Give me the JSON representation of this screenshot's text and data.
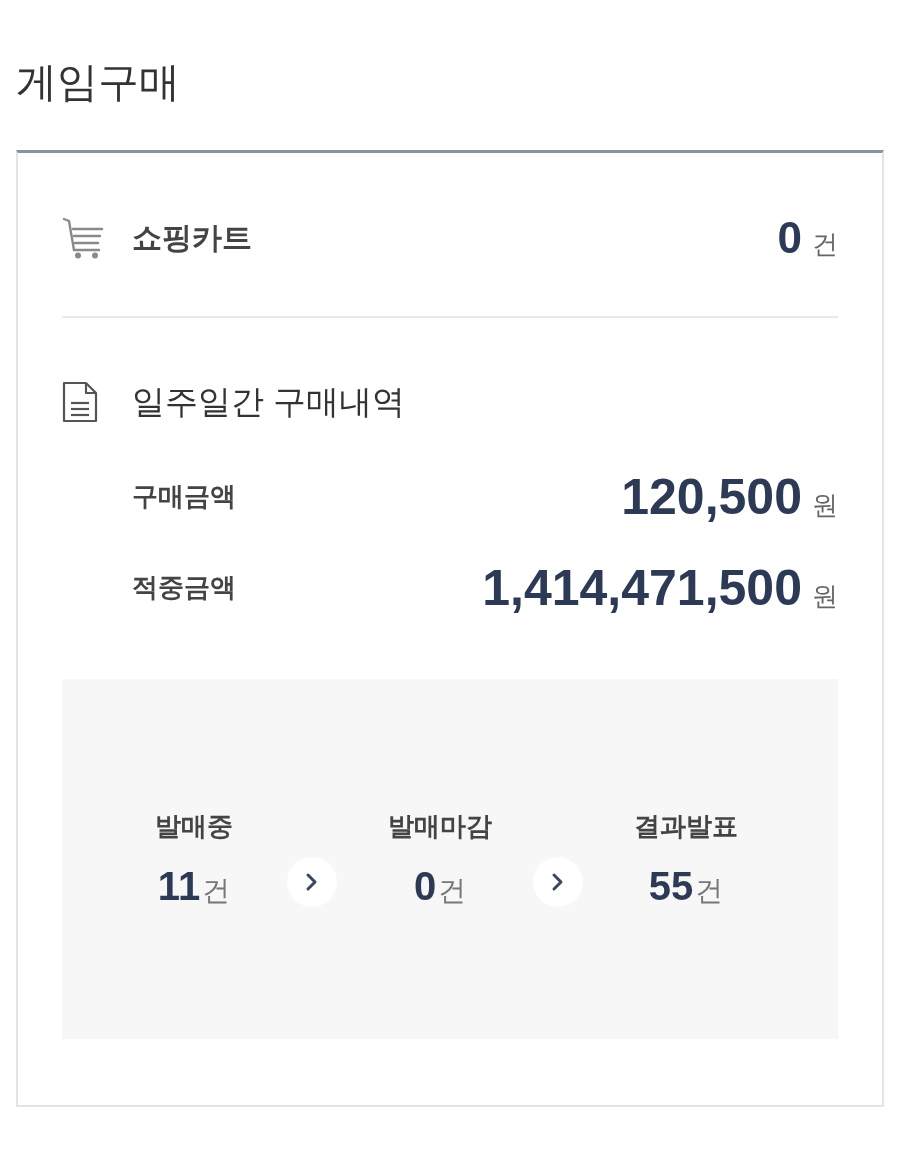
{
  "title": "게임구매",
  "cart": {
    "label": "쇼핑카트",
    "count": "0",
    "unit": "건"
  },
  "history": {
    "title": "일주일간 구매내역",
    "rows": [
      {
        "label": "구매금액",
        "value": "120,500",
        "unit": "원"
      },
      {
        "label": "적중금액",
        "value": "1,414,471,500",
        "unit": "원"
      }
    ]
  },
  "stages": [
    {
      "label": "발매중",
      "count": "11",
      "unit": "건"
    },
    {
      "label": "발매마감",
      "count": "0",
      "unit": "건"
    },
    {
      "label": "결과발표",
      "count": "55",
      "unit": "건"
    }
  ]
}
